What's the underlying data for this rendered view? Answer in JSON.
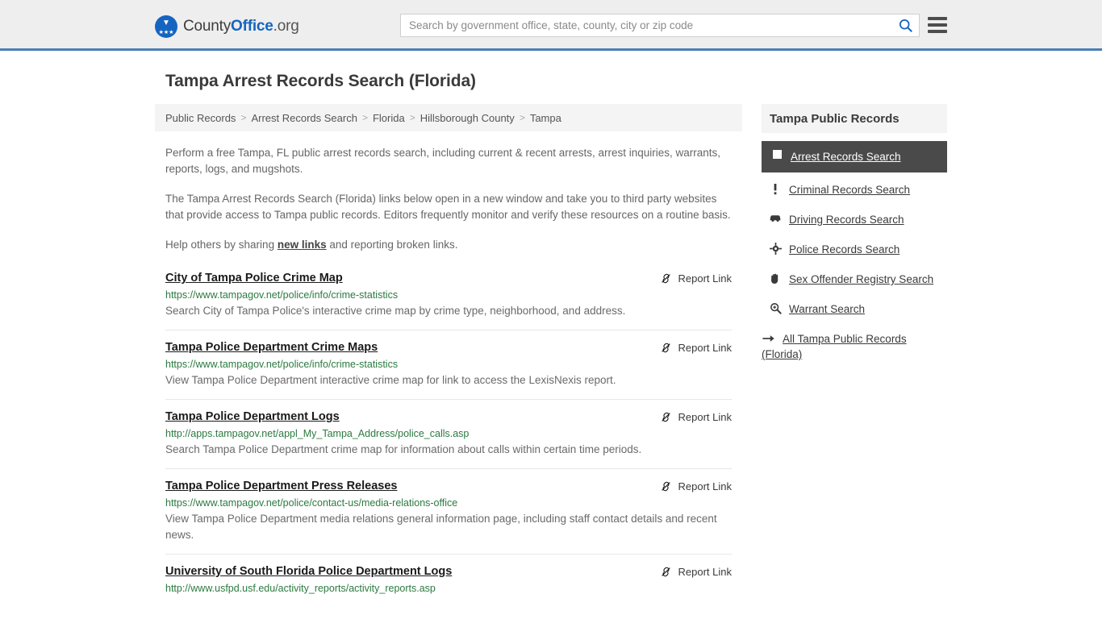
{
  "header": {
    "logo": {
      "icon": "county-office-seal-icon",
      "text_1": "County",
      "text_2": "Office",
      "text_3": ".org"
    },
    "search": {
      "placeholder": "Search by government office, state, county, city or zip code",
      "value": "",
      "icon": "search-icon"
    },
    "menu_icon": "hamburger-menu-icon",
    "accent_color": "#4a7fb5"
  },
  "page": {
    "title": "Tampa Arrest Records Search (Florida)"
  },
  "breadcrumb": {
    "separator": ">",
    "items": [
      "Public Records",
      "Arrest Records Search",
      "Florida",
      "Hillsborough County",
      "Tampa"
    ]
  },
  "intro": {
    "paragraph_1": "Perform a free Tampa, FL public arrest records search, including current & recent arrests, arrest inquiries, warrants, reports, logs, and mugshots.",
    "paragraph_2": "The Tampa Arrest Records Search (Florida) links below open in a new window and take you to third party websites that provide access to Tampa public records. Editors frequently monitor and verify these resources on a routine basis.",
    "paragraph_3_before": "Help others by sharing ",
    "paragraph_3_link": "new links",
    "paragraph_3_after": " and reporting broken links."
  },
  "results": {
    "report_label": "Report Link",
    "report_icon": "broken-link-icon",
    "items": [
      {
        "title": "City of Tampa Police Crime Map",
        "url": "https://www.tampagov.net/police/info/crime-statistics",
        "description": "Search City of Tampa Police's interactive crime map by crime type, neighborhood, and address."
      },
      {
        "title": "Tampa Police Department Crime Maps",
        "url": "https://www.tampagov.net/police/info/crime-statistics",
        "description": "View Tampa Police Department interactive crime map for link to access the LexisNexis report."
      },
      {
        "title": "Tampa Police Department Logs",
        "url": "http://apps.tampagov.net/appl_My_Tampa_Address/police_calls.asp",
        "description": "Search Tampa Police Department crime map for information about calls within certain time periods."
      },
      {
        "title": "Tampa Police Department Press Releases",
        "url": "https://www.tampagov.net/police/contact-us/media-relations-office",
        "description": "View Tampa Police Department media relations general information page, including staff contact details and recent news."
      },
      {
        "title": "University of South Florida Police Department Logs",
        "url": "http://www.usfpd.usf.edu/activity_reports/activity_reports.asp",
        "description": ""
      }
    ]
  },
  "sidebar": {
    "title": "Tampa Public Records",
    "items": [
      {
        "label": "Arrest Records Search",
        "icon": "white-square-icon",
        "active": true
      },
      {
        "label": "Criminal Records Search",
        "icon": "exclamation-icon",
        "active": false
      },
      {
        "label": "Driving Records Search",
        "icon": "car-icon",
        "active": false
      },
      {
        "label": "Police Records Search",
        "icon": "police-badge-icon",
        "active": false
      },
      {
        "label": "Sex Offender Registry Search",
        "icon": "hand-icon",
        "active": false
      },
      {
        "label": "Warrant Search",
        "icon": "magnifier-plus-icon",
        "active": false
      },
      {
        "label": "All Tampa Public Records (Florida)",
        "icon": "arrow-right-icon",
        "active": false
      }
    ]
  }
}
